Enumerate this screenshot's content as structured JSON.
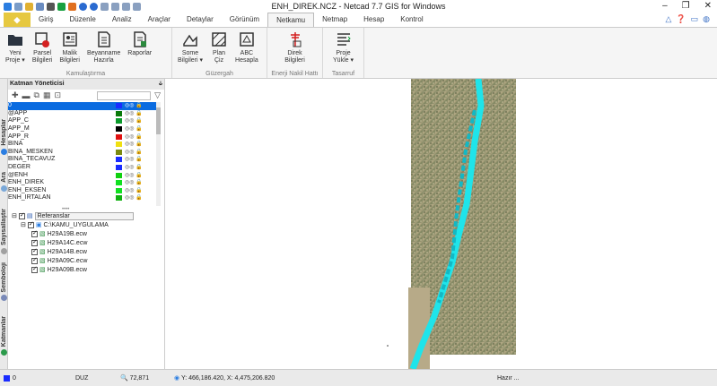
{
  "window": {
    "title": "ENH_DIREK.NCZ - Netcad 7.7 GIS for Windows",
    "controls": [
      "–",
      "❐",
      "✕"
    ]
  },
  "tabs": {
    "file_label": "",
    "items": [
      "Giriş",
      "Düzenle",
      "Analiz",
      "Araçlar",
      "Detaylar",
      "Görünüm",
      "Netkamu",
      "Netmap",
      "Hesap",
      "Kontrol"
    ],
    "active": "Netkamu"
  },
  "ribbon": {
    "groups": [
      {
        "label": "Kamulaştırma",
        "buttons": [
          {
            "label": "Yeni\nProje ▾",
            "icon": "folder-icon"
          },
          {
            "label": "Parsel\nBilgileri",
            "icon": "parcel-info-icon"
          },
          {
            "label": "Malik\nBilgileri",
            "icon": "owner-info-icon"
          },
          {
            "label": "Beyanname\nHazırla",
            "icon": "document-icon"
          },
          {
            "label": "Raporlar",
            "icon": "report-icon"
          }
        ]
      },
      {
        "label": "Güzergah",
        "buttons": [
          {
            "label": "Some\nBilgileri ▾",
            "icon": "some-info-icon"
          },
          {
            "label": "Plan\nÇiz",
            "icon": "plan-draw-icon"
          },
          {
            "label": "ABC\nHesapla",
            "icon": "abc-calc-icon"
          }
        ]
      },
      {
        "label": "Enerji Nakil Hattı",
        "buttons": [
          {
            "label": "Direk\nBilgileri",
            "icon": "pole-info-icon"
          }
        ]
      },
      {
        "label": "Tasarruf",
        "buttons": [
          {
            "label": "Proje\nYükle ▾",
            "icon": "project-load-icon"
          }
        ]
      }
    ]
  },
  "side_tabs": [
    "Hesaplar",
    "Ara",
    "Sayısallaştır",
    "Semboloji",
    "Katmanlar"
  ],
  "layer_panel": {
    "title": "Katman Yöneticisi",
    "pin": "⫝",
    "layers": [
      {
        "name": "0",
        "color": "#1a2cff",
        "selected": true
      },
      {
        "name": "@APP",
        "color": "#0a7a0a"
      },
      {
        "name": "APP_C",
        "color": "#0a9a2a"
      },
      {
        "name": "APP_M",
        "color": "#000000"
      },
      {
        "name": "APP_R",
        "color": "#e01010"
      },
      {
        "name": "BINA",
        "color": "#f0e010"
      },
      {
        "name": "BINA_MESKEN",
        "color": "#7a8a10"
      },
      {
        "name": "BINA_TECAVUZ",
        "color": "#1a2cff"
      },
      {
        "name": "DEGER",
        "color": "#1a2cff"
      },
      {
        "name": "@ENH",
        "color": "#10d010"
      },
      {
        "name": "ENH_DIREK",
        "color": "#10e020"
      },
      {
        "name": "ENH_EKSEN",
        "color": "#10e020"
      },
      {
        "name": "ENH_IRTALAN",
        "color": "#10b010"
      }
    ],
    "flags": "◎◎ 🔒"
  },
  "references": {
    "root": "Referanslar",
    "folder": "C:\\KAMU_UYGULAMA",
    "files": [
      "H29A19B.ecw",
      "H29A14C.ecw",
      "H29A14B.ecw",
      "H29A09C.ecw",
      "H29A09B.ecw"
    ]
  },
  "status": {
    "layer": "0",
    "mode": "DUZ",
    "scale": "72,871",
    "coords": "Y: 466,186.420, X: 4,475,206.820",
    "ready": "Hazır ..."
  },
  "colors": {
    "accent": "#0a6be0",
    "corridor": "#1fe4ea",
    "file_tab": "#e6c840"
  }
}
